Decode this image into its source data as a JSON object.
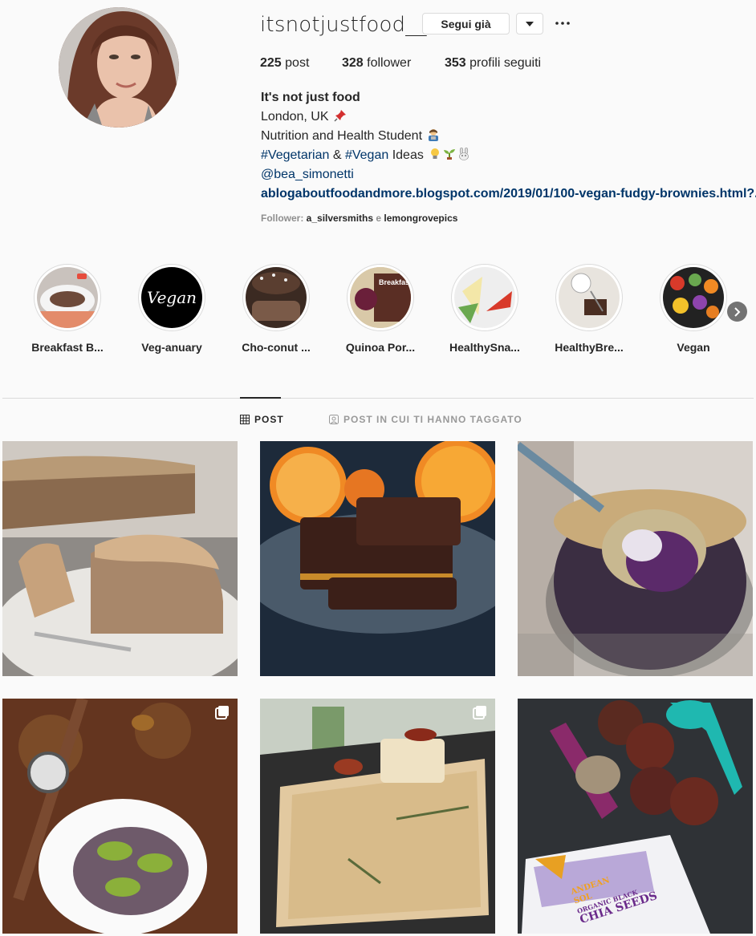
{
  "profile": {
    "username": "itsnotjustfood__",
    "follow_label": "Segui già",
    "more_label": "···",
    "stats": {
      "posts_count": "225",
      "posts_label": " post",
      "followers_count": "328",
      "followers_label": " follower",
      "following_count": "353",
      "following_label": " profili seguiti"
    },
    "bio": {
      "name": "It's not just food",
      "location": "London, UK",
      "line2": "Nutrition and Health Student",
      "hashtag1": "#Vegetarian",
      "amp": " & ",
      "hashtag2": "#Vegan",
      "ideas": " Ideas",
      "mention": "@bea_simonetti",
      "url": "ablogaboutfoodandmore.blogspot.com/2019/01/100-vegan-fudgy-brownies.html?..."
    },
    "followed_by": {
      "prefix": "Follower: ",
      "user1": "a_silversmiths",
      "conj": " e ",
      "user2": "lemongrovepics"
    }
  },
  "highlights": [
    {
      "label": "Breakfast B..."
    },
    {
      "label": "Veg-anuary",
      "cover_text": "Vegan"
    },
    {
      "label": "Cho-conut ..."
    },
    {
      "label": "Quinoa Por...",
      "cover_text": "Breakfast"
    },
    {
      "label": "HealthySna..."
    },
    {
      "label": "HealthyBre..."
    },
    {
      "label": "Vegan"
    }
  ],
  "tabs": {
    "posts_label": "POST",
    "tagged_label": "POST IN CUI TI HANNO TAGGATO"
  },
  "posts": [
    {
      "alt": "pie slice on plate with fork",
      "multi": false
    },
    {
      "alt": "chocolate brownies with oranges",
      "multi": false
    },
    {
      "alt": "chia pudding jar with spoon",
      "multi": false
    },
    {
      "alt": "kiwi porridge bowl with watch",
      "multi": true
    },
    {
      "alt": "focaccia with rosemary",
      "multi": true
    },
    {
      "alt": "chia seed muffins",
      "multi": false,
      "package_lines": [
        "ANDEAN",
        "SOL",
        "ORGANIC BLACK",
        "CHIA SEEDS"
      ]
    }
  ],
  "colors": {
    "text": "#262626",
    "link": "#003569",
    "muted": "#8e8e8e",
    "border": "#dbdbdb",
    "background": "#fafafa"
  }
}
